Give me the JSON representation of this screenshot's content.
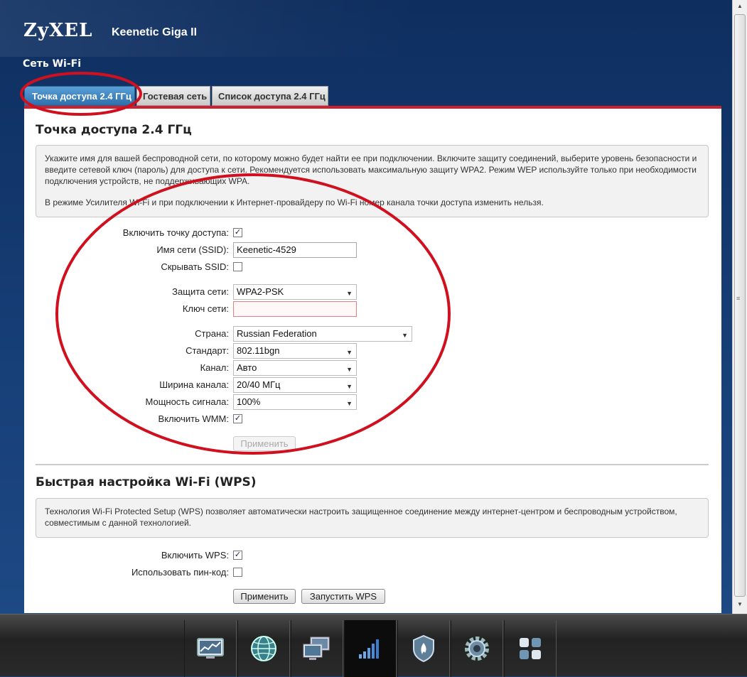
{
  "header": {
    "logo": "ZyXEL",
    "model": "Keenetic Giga II",
    "section": "Сеть Wi-Fi"
  },
  "tabs": [
    {
      "label": "Точка доступа 2.4 ГГц",
      "active": true
    },
    {
      "label": "Гостевая сеть",
      "active": false
    },
    {
      "label": "Список доступа 2.4 ГГц",
      "active": false
    }
  ],
  "ap": {
    "title": "Точка доступа 2.4 ГГц",
    "info1": "Укажите имя для вашей беспроводной сети, по которому можно будет найти ее при подключении. Включите защиту соединений, выберите уровень безопасности и введите сетевой ключ (пароль) для доступа к сети. Рекомендуется использовать максимальную защиту WPA2. Режим WEP используйте только при необходимости подключения устройств, не поддерживающих WPA.",
    "info2": "В режиме Усилителя Wi-Fi и при подключении к Интернет-провайдеру по Wi-Fi номер канала точки доступа изменить нельзя.",
    "enable_label": "Включить точку доступа:",
    "enable_checked": true,
    "ssid_label": "Имя сети (SSID):",
    "ssid_value": "Keenetic-4529",
    "hide_label": "Скрывать SSID:",
    "hide_checked": false,
    "security_label": "Защита сети:",
    "security_value": "WPA2-PSK",
    "key_label": "Ключ сети:",
    "key_value": "",
    "country_label": "Страна:",
    "country_value": "Russian Federation",
    "standard_label": "Стандарт:",
    "standard_value": "802.11bgn",
    "channel_label": "Канал:",
    "channel_value": "Авто",
    "width_label": "Ширина канала:",
    "width_value": "20/40 МГц",
    "power_label": "Мощность сигнала:",
    "power_value": "100%",
    "wmm_label": "Включить WMM:",
    "wmm_checked": true,
    "apply_label": "Применить"
  },
  "wps": {
    "title": "Быстрая настройка Wi-Fi (WPS)",
    "info": "Технология Wi-Fi Protected Setup (WPS) позволяет автоматически настроить защищенное соединение между интернет-центром и беспроводным устройством, совместимым с данной технологией.",
    "enable_label": "Включить WPS:",
    "enable_checked": true,
    "pin_label": "Использовать пин-код:",
    "pin_checked": false,
    "apply_label": "Применить",
    "start_label": "Запустить WPS"
  },
  "taskbar": {
    "items": [
      {
        "icon": "monitor-graph-icon",
        "active": false
      },
      {
        "icon": "globe-icon",
        "active": false
      },
      {
        "icon": "network-computers-icon",
        "active": false
      },
      {
        "icon": "wifi-signal-bars-icon",
        "active": true
      },
      {
        "icon": "security-shield-icon",
        "active": false
      },
      {
        "icon": "settings-gear-icon",
        "active": false
      },
      {
        "icon": "apps-grid-icon",
        "active": false
      }
    ]
  },
  "colors": {
    "header_bg": "#173f78",
    "tab_active": "#3d85c6",
    "accent_red": "#cf2030",
    "annotation_red": "#d0101e"
  }
}
